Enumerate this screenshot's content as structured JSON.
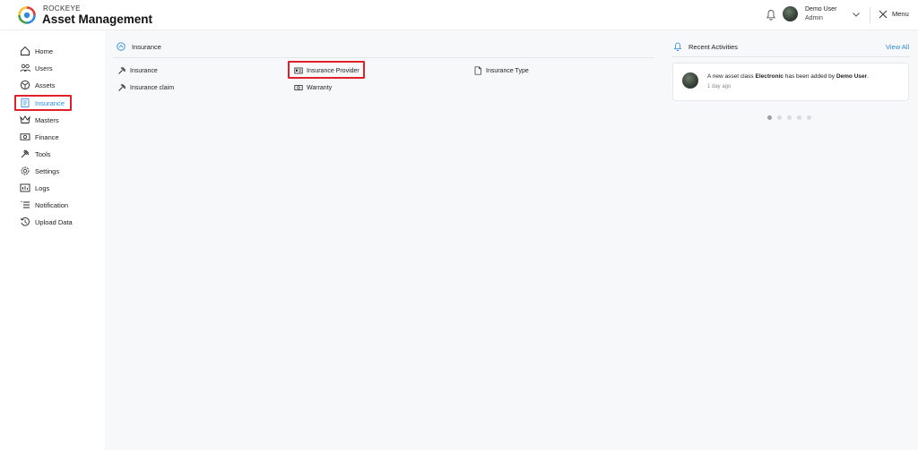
{
  "header": {
    "brand_small": "ROCKEYE",
    "brand_big": "Asset Management",
    "user_name": "Demo User",
    "user_role": "Admin",
    "menu_label": "Menu"
  },
  "sidebar": {
    "items": [
      {
        "label": "Home",
        "icon": "home-icon"
      },
      {
        "label": "Users",
        "icon": "users-icon"
      },
      {
        "label": "Assets",
        "icon": "assets-icon"
      },
      {
        "label": "Insurance",
        "icon": "insurance-icon",
        "active": true
      },
      {
        "label": "Masters",
        "icon": "crown-icon"
      },
      {
        "label": "Finance",
        "icon": "cash-icon"
      },
      {
        "label": "Tools",
        "icon": "tools-icon"
      },
      {
        "label": "Settings",
        "icon": "gear-icon"
      },
      {
        "label": "Logs",
        "icon": "logs-icon"
      },
      {
        "label": "Notification",
        "icon": "notification-list-icon"
      },
      {
        "label": "Upload Data",
        "icon": "upload-history-icon"
      }
    ]
  },
  "insurance_panel": {
    "title": "Insurance",
    "links": [
      {
        "label": "Insurance",
        "icon": "hammer-icon"
      },
      {
        "label": "Insurance Provider",
        "icon": "id-card-icon",
        "highlighted": true
      },
      {
        "label": "Insurance Type",
        "icon": "document-icon"
      },
      {
        "label": "Insurance claim",
        "icon": "hammer-icon"
      },
      {
        "label": "Warranty",
        "icon": "cash-icon"
      }
    ]
  },
  "activities": {
    "title": "Recent Activities",
    "view_all": "View All",
    "item": {
      "text_prefix": "A new asset class ",
      "text_bold_1": "Electronic",
      "text_mid": " has been added by ",
      "text_bold_2": "Demo User",
      "text_suffix": ".",
      "time": "1 day ago"
    },
    "carousel": {
      "count": 5,
      "active_index": 0
    }
  },
  "colors": {
    "accent": "#2d8ae0",
    "highlight": "#e0202a"
  }
}
